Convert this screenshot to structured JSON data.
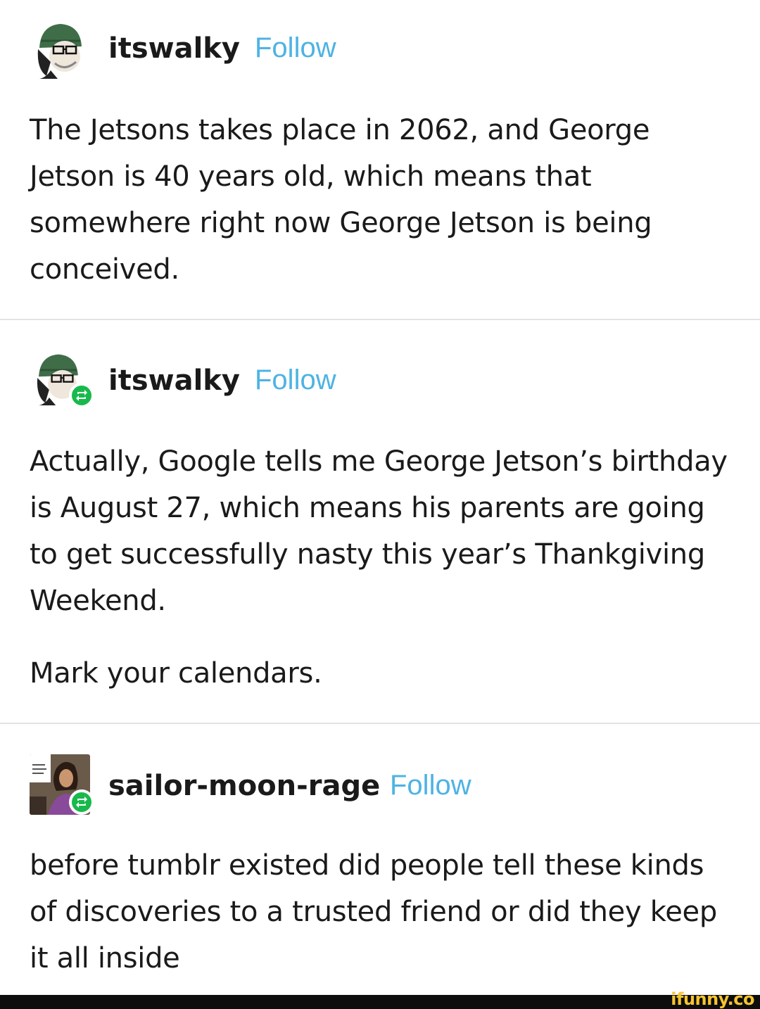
{
  "posts": [
    {
      "username": "itswalky",
      "follow_label": "Follow",
      "avatar_icon": "cartoon-beanie-avatar-icon",
      "reblog": false,
      "paragraphs": [
        "The Jetsons takes place in 2062, and George Jetson is 40 years old, which means that somewhere right now George Jetson is being conceived."
      ]
    },
    {
      "username": "itswalky",
      "follow_label": "Follow",
      "avatar_icon": "cartoon-beanie-avatar-icon",
      "reblog": true,
      "paragraphs": [
        "Actually, Google tells me George Jetson’s birthday is August 27, which means his parents are going to get successfully nasty this year’s Thankgiving Weekend.",
        "Mark your calendars."
      ]
    },
    {
      "username": "sailor-moon-rage",
      "follow_label": "Follow",
      "avatar_icon": "woman-photo-avatar-icon",
      "reblog": true,
      "paragraphs": [
        "before tumblr existed did people tell these kinds of discoveries to a trusted friend or did they keep it all inside"
      ]
    }
  ],
  "watermark": "ifunny.co",
  "colors": {
    "follow": "#4eb3e3",
    "reblog_badge": "#18b94c",
    "divider": "#e3e3e3",
    "watermark": "#f5c430"
  }
}
